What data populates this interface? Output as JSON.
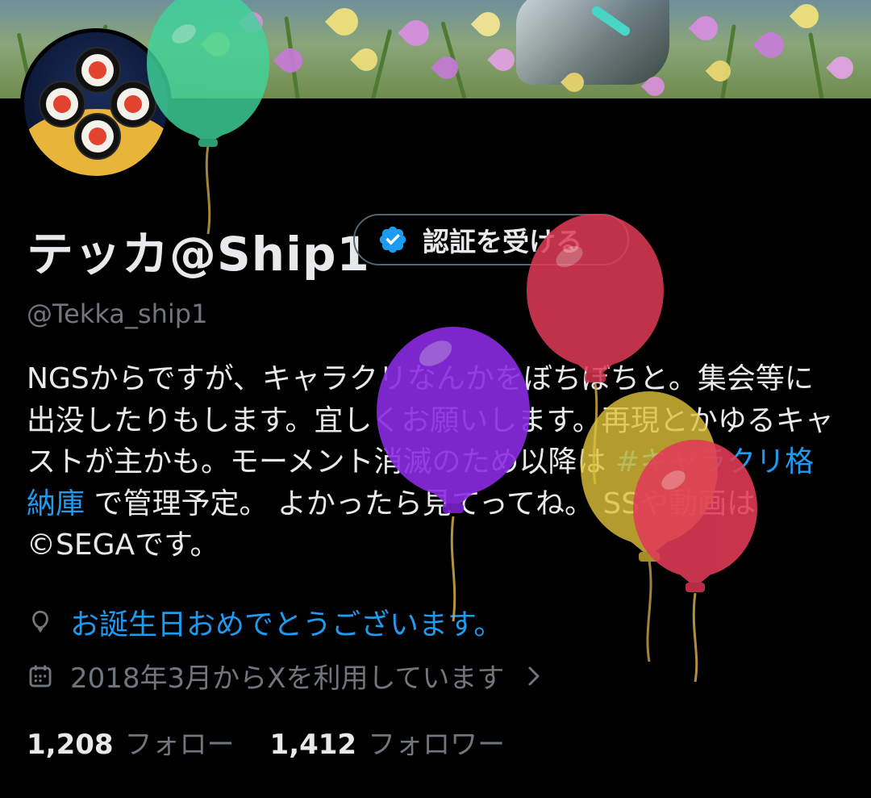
{
  "profile": {
    "display_name": "テッカ@Ship1",
    "handle": "@Tekka_ship1",
    "verify_button_label": "認証を受ける",
    "bio_before_hashtag": "NGSからですが、キャラクリなんかをぼちぼちと。集会等に出没したりもします。宜しくお願いします。再現とかゆるキャストが主かも。モーメント消滅のため以降は ",
    "bio_hashtag": "#キャラクリ格納庫",
    "bio_after_hashtag": " で管理予定。 よかったら見てってね。 SSや動画は©SEGAです。",
    "birthday_text": "お誕生日おめでとうございます。",
    "joined_text": "2018年3月からXを利用しています"
  },
  "stats": {
    "following_count": "1,208",
    "following_label": "フォロー",
    "followers_count": "1,412",
    "followers_label": "フォロワー"
  },
  "icons": {
    "verify": "verified-badge-icon",
    "birthday": "balloon-icon",
    "joined": "calendar-icon",
    "chevron": "chevron-right-icon"
  },
  "colors": {
    "background": "#000000",
    "link": "#1d9bf0",
    "muted": "#71767b",
    "text": "#e7e9ea"
  }
}
